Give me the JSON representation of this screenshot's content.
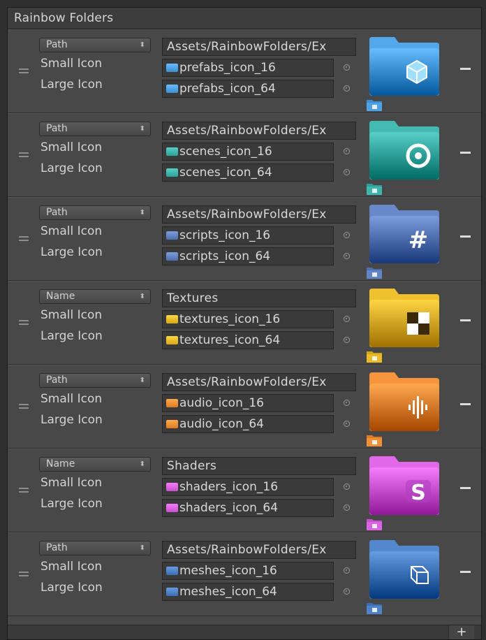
{
  "panel": {
    "title": "Rainbow Folders"
  },
  "colors": {
    "blue": "#3a8fd3",
    "teal": "#2aa29a",
    "slate": "#4e6fb0",
    "yellow": "#d6a816",
    "orange": "#dd7c22",
    "rainbow": "#c84fd0",
    "navy": "#3a6fb5"
  },
  "rows": [
    {
      "mode": "Path",
      "path": "Assets/RainbowFolders/Ex",
      "small_label": "Small Icon",
      "large_label": "Large Icon",
      "small_icon": "prefabs_icon_16",
      "large_icon": "prefabs_icon_64",
      "symbol": "cube-icon",
      "color": "blue"
    },
    {
      "mode": "Path",
      "path": "Assets/RainbowFolders/Ex",
      "small_label": "Small Icon",
      "large_label": "Large Icon",
      "small_icon": "scenes_icon_16",
      "large_icon": "scenes_icon_64",
      "symbol": "aperture-icon",
      "color": "teal"
    },
    {
      "mode": "Path",
      "path": "Assets/RainbowFolders/Ex",
      "small_label": "Small Icon",
      "large_label": "Large Icon",
      "small_icon": "scripts_icon_16",
      "large_icon": "scripts_icon_64",
      "symbol": "hash-icon",
      "color": "slate"
    },
    {
      "mode": "Name",
      "path": "Textures",
      "small_label": "Small Icon",
      "large_label": "Large Icon",
      "small_icon": "textures_icon_16",
      "large_icon": "textures_icon_64",
      "symbol": "checker-icon",
      "color": "yellow"
    },
    {
      "mode": "Path",
      "path": "Assets/RainbowFolders/Ex",
      "small_label": "Small Icon",
      "large_label": "Large Icon",
      "small_icon": "audio_icon_16",
      "large_icon": "audio_icon_64",
      "symbol": "waveform-icon",
      "color": "orange"
    },
    {
      "mode": "Name",
      "path": "Shaders",
      "small_label": "Small Icon",
      "large_label": "Large Icon",
      "small_icon": "shaders_icon_16",
      "large_icon": "shaders_icon_64",
      "symbol": "letter-s-icon",
      "color": "rainbow"
    },
    {
      "mode": "Path",
      "path": "Assets/RainbowFolders/Ex",
      "small_label": "Small Icon",
      "large_label": "Large Icon",
      "small_icon": "meshes_icon_16",
      "large_icon": "meshes_icon_64",
      "symbol": "wireframe-cube-icon",
      "color": "navy"
    }
  ],
  "footer": {
    "add_label": "+"
  }
}
